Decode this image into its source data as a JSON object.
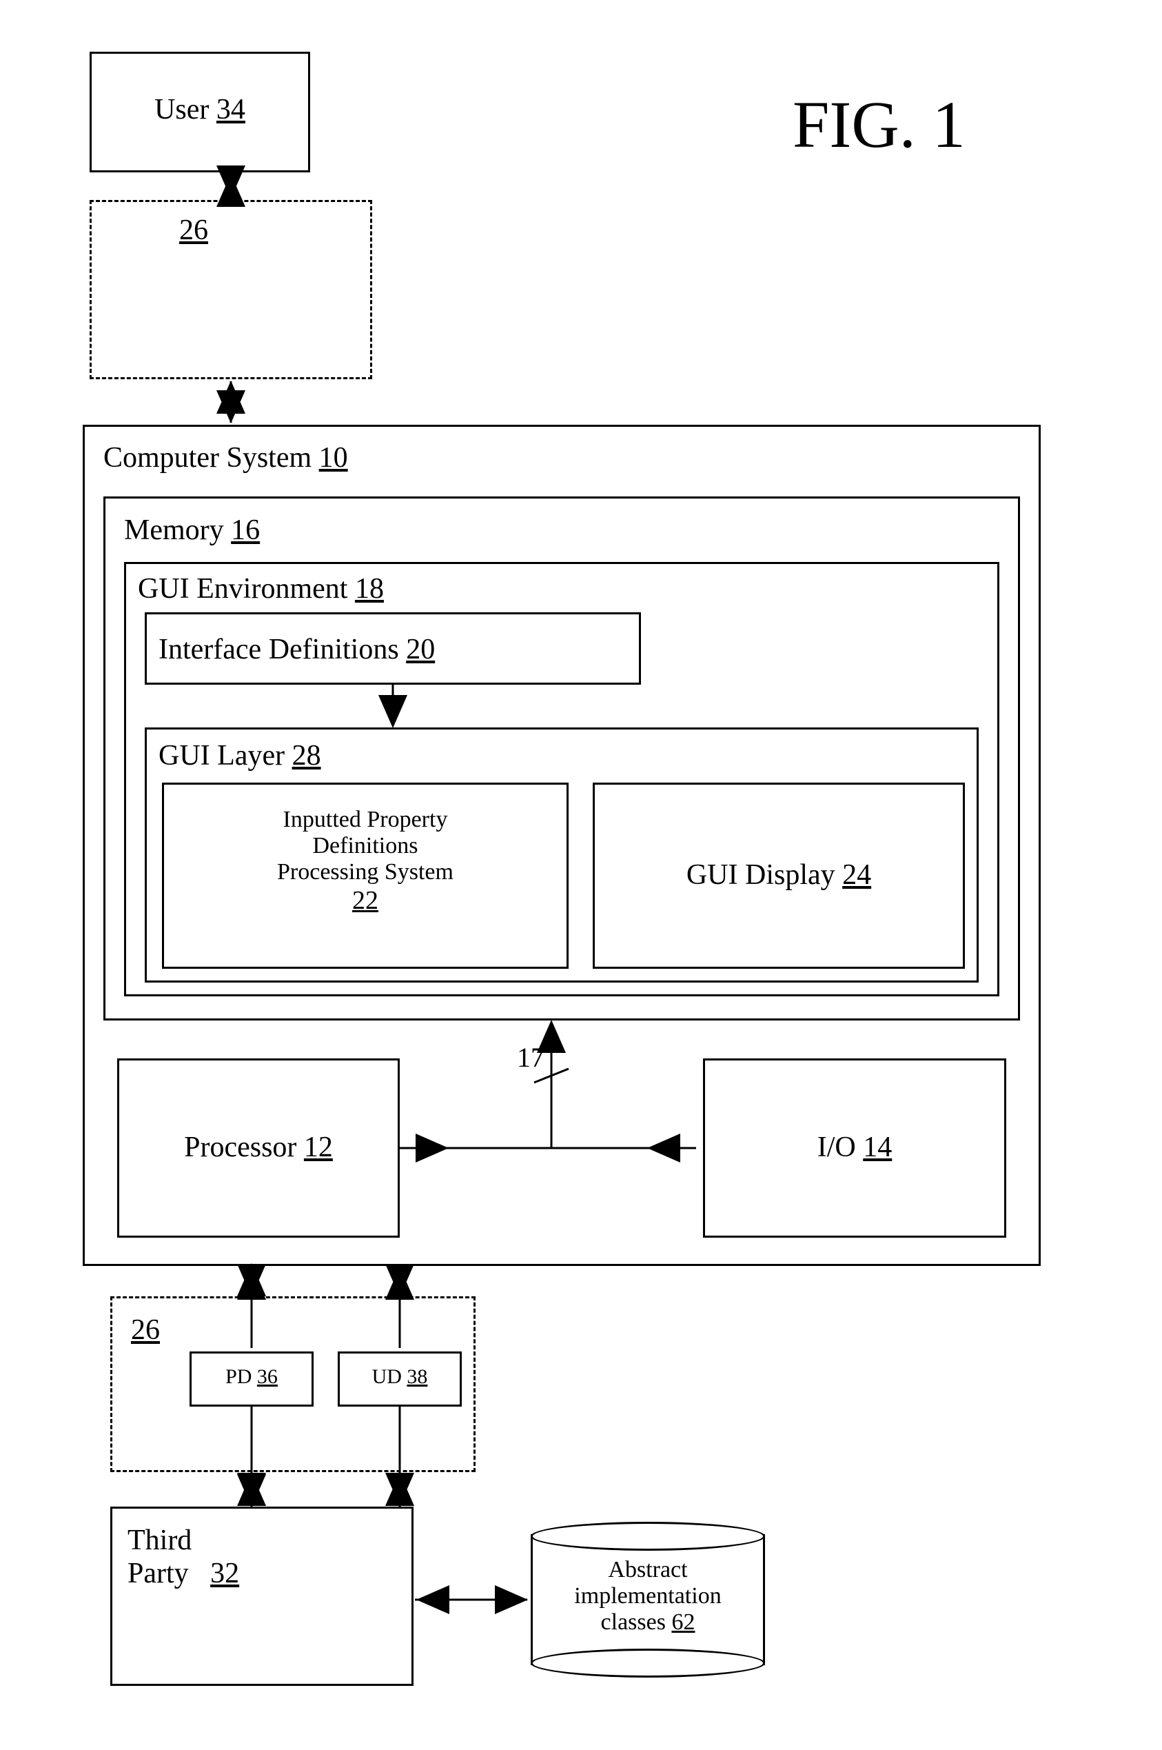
{
  "figure_label": "FIG. 1",
  "computer_system": {
    "label": "Computer System",
    "ref": "10"
  },
  "processor": {
    "label": "Processor",
    "ref": "12"
  },
  "io": {
    "label": "I/O",
    "ref": "14"
  },
  "bus_ref": "17",
  "memory": {
    "label": "Memory",
    "ref": "16"
  },
  "gui_env": {
    "label": "GUI Environment",
    "ref": "18"
  },
  "interface_defs": {
    "label": "Interface Definitions",
    "ref": "20"
  },
  "gui_layer": {
    "label": "GUI Layer",
    "ref": "28"
  },
  "ipdps": {
    "line1": "Inputted Property",
    "line2": "Definitions",
    "line3": "Processing System",
    "ref": "22"
  },
  "gui_display": {
    "label": "GUI Display",
    "ref": "24"
  },
  "third_party": {
    "line1": "Third",
    "line2": "Party",
    "ref": "32"
  },
  "pd": {
    "label": "PD",
    "ref": "36"
  },
  "ud": {
    "label": "UD",
    "ref": "38"
  },
  "network_left_ref": "26",
  "network_right_ref": "26",
  "user": {
    "label": "User",
    "ref": "34"
  },
  "abstract_classes": {
    "line1": "Abstract",
    "line2": "implementation",
    "line3": "classes",
    "ref": "62"
  }
}
